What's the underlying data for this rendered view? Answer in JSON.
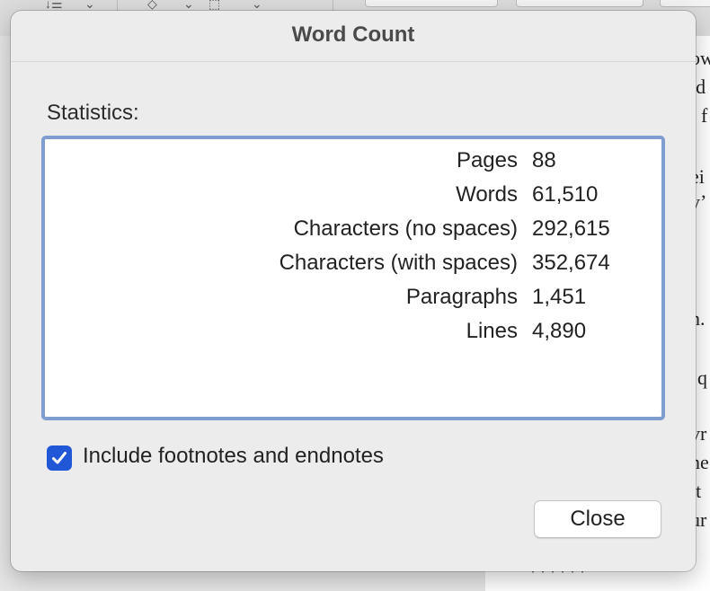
{
  "dialog": {
    "title": "Word Count",
    "statistics_label": "Statistics:",
    "stats": [
      {
        "label": "Pages",
        "value": "88"
      },
      {
        "label": "Words",
        "value": "61,510"
      },
      {
        "label": "Characters (no spaces)",
        "value": "292,615"
      },
      {
        "label": "Characters (with spaces)",
        "value": "352,674"
      },
      {
        "label": "Paragraphs",
        "value": "1,451"
      },
      {
        "label": "Lines",
        "value": "4,890"
      }
    ],
    "include_footnotes": {
      "label": "Include footnotes and endnotes",
      "checked": true
    },
    "close_label": "Close"
  },
  "background_document": {
    "fragments": [
      "ow",
      "id",
      "f",
      "ei",
      "y’",
      "n.",
      "q",
      "vr",
      "ne",
      "lt",
      "ur"
    ],
    "stars": "******"
  },
  "colors": {
    "accent": "#1f57d6",
    "box_border": "#7f9dd0",
    "dialog_bg": "#ececec"
  }
}
